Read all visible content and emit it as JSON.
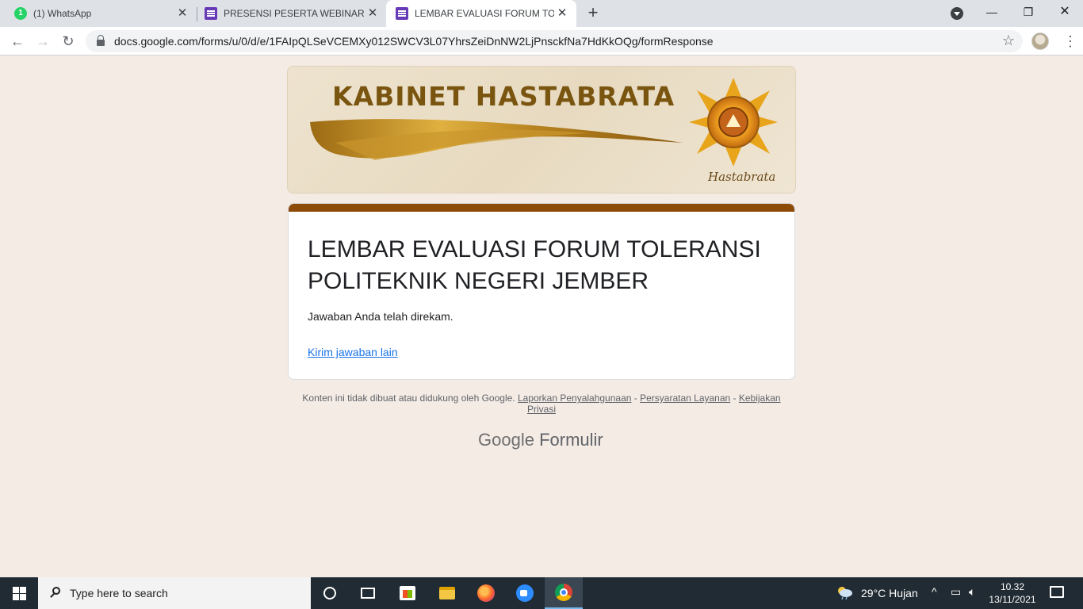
{
  "browser": {
    "tabs": [
      {
        "title": "(1) WhatsApp",
        "badge": "1",
        "icon": "whatsapp-icon",
        "active": false
      },
      {
        "title": "PRESENSI PESERTA WEBINAR FO",
        "icon": "google-forms-icon",
        "active": false
      },
      {
        "title": "LEMBAR EVALUASI FORUM TOLE",
        "icon": "google-forms-icon",
        "active": true
      }
    ],
    "url": "docs.google.com/forms/u/0/d/e/1FAIpQLSeVCEMXy012SWCV3L07YhrsZeiDnNW2LjPnsckfNa7HdKkOQg/formResponse"
  },
  "banner": {
    "title": "KABINET HASTABRATA",
    "logo_text": "Hastabrata"
  },
  "form": {
    "title": "LEMBAR EVALUASI FORUM TOLERANSI POLITEKNIK NEGERI JEMBER",
    "confirmation": "Jawaban Anda telah direkam.",
    "submit_another": "Kirim jawaban lain",
    "accent_color": "#8c4b06"
  },
  "footer": {
    "disclaimer": "Konten ini tidak dibuat atau didukung oleh Google.",
    "link_abuse": "Laporkan Penyalahgunaan",
    "link_terms": "Persyaratan Layanan",
    "link_privacy": "Kebijakan Privasi",
    "separator": " - ",
    "brand_google": "Google",
    "brand_forms": "Formulir"
  },
  "taskbar": {
    "search_placeholder": "Type here to search",
    "weather": "29°C  Hujan",
    "time": "10.32",
    "date": "13/11/2021"
  }
}
